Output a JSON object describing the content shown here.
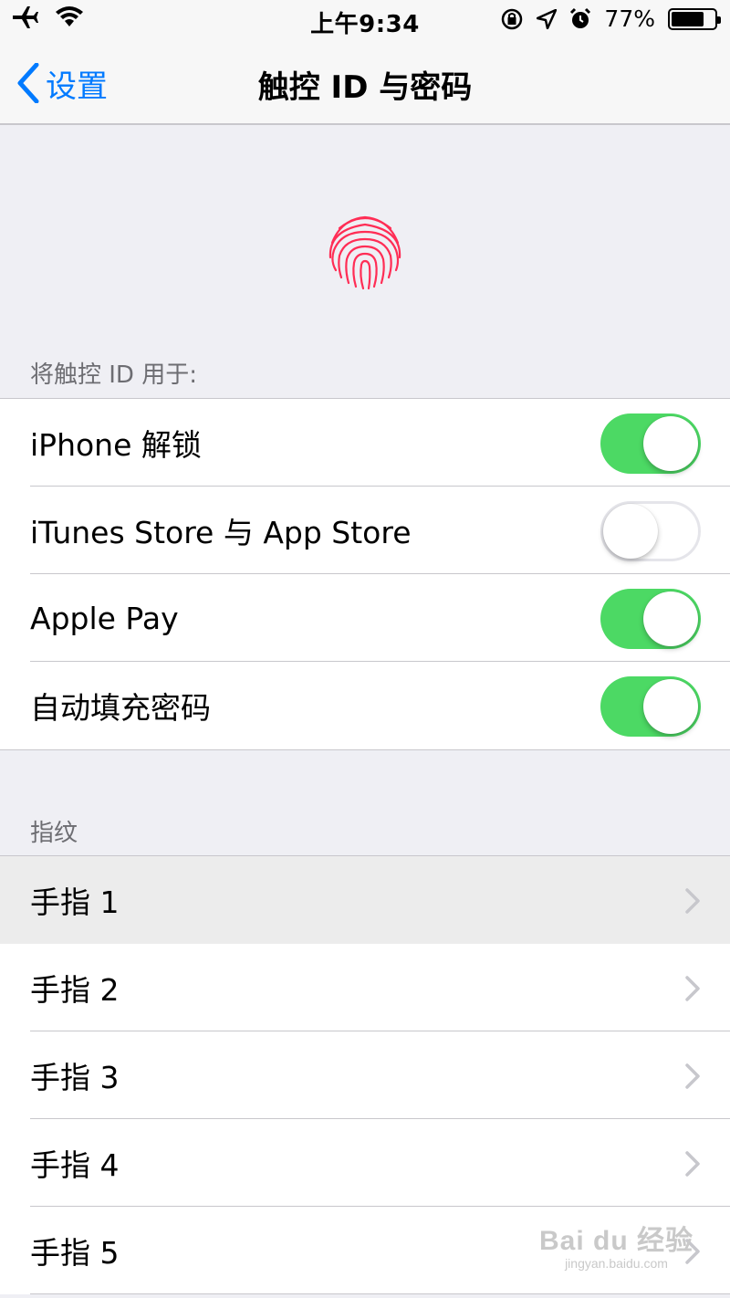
{
  "status_bar": {
    "time": "上午9:34",
    "battery_percent": "77%",
    "battery_level": 0.77,
    "icons": [
      "airplane-icon",
      "wifi-icon",
      "rotation-lock-icon",
      "location-icon",
      "alarm-icon",
      "battery-icon"
    ]
  },
  "nav": {
    "back_label": "设置",
    "title": "触控 ID 与密码"
  },
  "touch_id_section": {
    "header": "将触控 ID 用于:",
    "items": [
      {
        "label": "iPhone 解锁",
        "on": true
      },
      {
        "label": "iTunes Store 与 App Store",
        "on": false
      },
      {
        "label": "Apple Pay",
        "on": true
      },
      {
        "label": "自动填充密码",
        "on": true
      }
    ]
  },
  "fingerprints_section": {
    "header": "指纹",
    "items": [
      {
        "label": "手指 1"
      },
      {
        "label": "手指 2"
      },
      {
        "label": "手指 3"
      },
      {
        "label": "手指 4"
      },
      {
        "label": "手指 5"
      }
    ]
  },
  "watermark": {
    "main": "Bai du 经验",
    "sub": "jingyan.baidu.com"
  },
  "colors": {
    "accent": "#007aff",
    "toggle_on": "#4cd964",
    "fingerprint": "#ff2d55",
    "background": "#efeff4"
  }
}
